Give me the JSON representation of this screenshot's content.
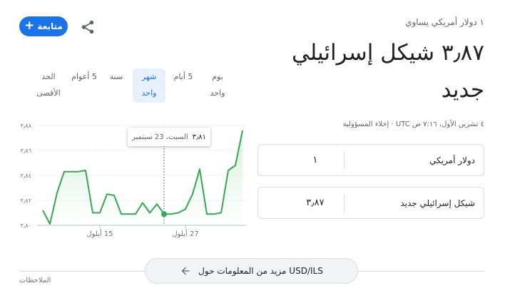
{
  "header": {
    "follow_label": "متابعة",
    "subtitle": "١ دولار أمريكي يساوي",
    "value": "٣٫٨٧ شيكل إسرائيلي جديد",
    "timestamp": "٤ تشرين الأول، ٧:١٦ ص UTC",
    "separator": "·",
    "disclaimer": "إخلاء المسؤولية"
  },
  "converter": {
    "from_value": "١",
    "from_unit": "دولار أمريكي",
    "to_value": "٣٫٨٧",
    "to_unit": "شيكل إسرائيلي جديد"
  },
  "range_tabs": [
    {
      "label_line1": "يوم",
      "label_line2": "واحد",
      "active": false
    },
    {
      "label_line1": "5 أيام",
      "label_line2": "",
      "active": false
    },
    {
      "label_line1": "شهر",
      "label_line2": "واحد",
      "active": true
    },
    {
      "label_line1": "سنة",
      "label_line2": "",
      "active": false
    },
    {
      "label_line1": "5 أعوام",
      "label_line2": "",
      "active": false
    },
    {
      "label_line1": "الحد",
      "label_line2": "الأقصى",
      "active": false
    }
  ],
  "tooltip": {
    "value": "٣٫٨١",
    "date": "السبت، 23 سبتمبر"
  },
  "chart_data": {
    "type": "area",
    "ylim": [
      3.8,
      3.88
    ],
    "y_ticks": [
      {
        "value": 3.88,
        "label": "٣٫٨٨"
      },
      {
        "value": 3.86,
        "label": "٣٫٨٦"
      },
      {
        "value": 3.84,
        "label": "٣٫٨٤"
      },
      {
        "value": 3.82,
        "label": "٣٫٨٢"
      },
      {
        "value": 3.8,
        "label": "٣٫٨٠"
      }
    ],
    "x_ticks": [
      {
        "index": 8,
        "label": "15 أيلول"
      },
      {
        "index": 20,
        "label": "27 أيلول"
      }
    ],
    "values": [
      3.812,
      3.801,
      3.826,
      3.843,
      3.843,
      3.843,
      3.844,
      3.81,
      3.81,
      3.825,
      3.824,
      3.809,
      3.809,
      3.809,
      3.818,
      3.81,
      3.817,
      3.809,
      3.809,
      3.81,
      3.813,
      3.825,
      3.845,
      3.809,
      3.809,
      3.81,
      3.844,
      3.848,
      3.876
    ],
    "highlight_index": 17,
    "line_color": "#34a853",
    "grid": true
  },
  "footer": {
    "more_label": "مزيد من المعلومات حول USD/ILS",
    "feedback_label": "الملاحظات"
  }
}
